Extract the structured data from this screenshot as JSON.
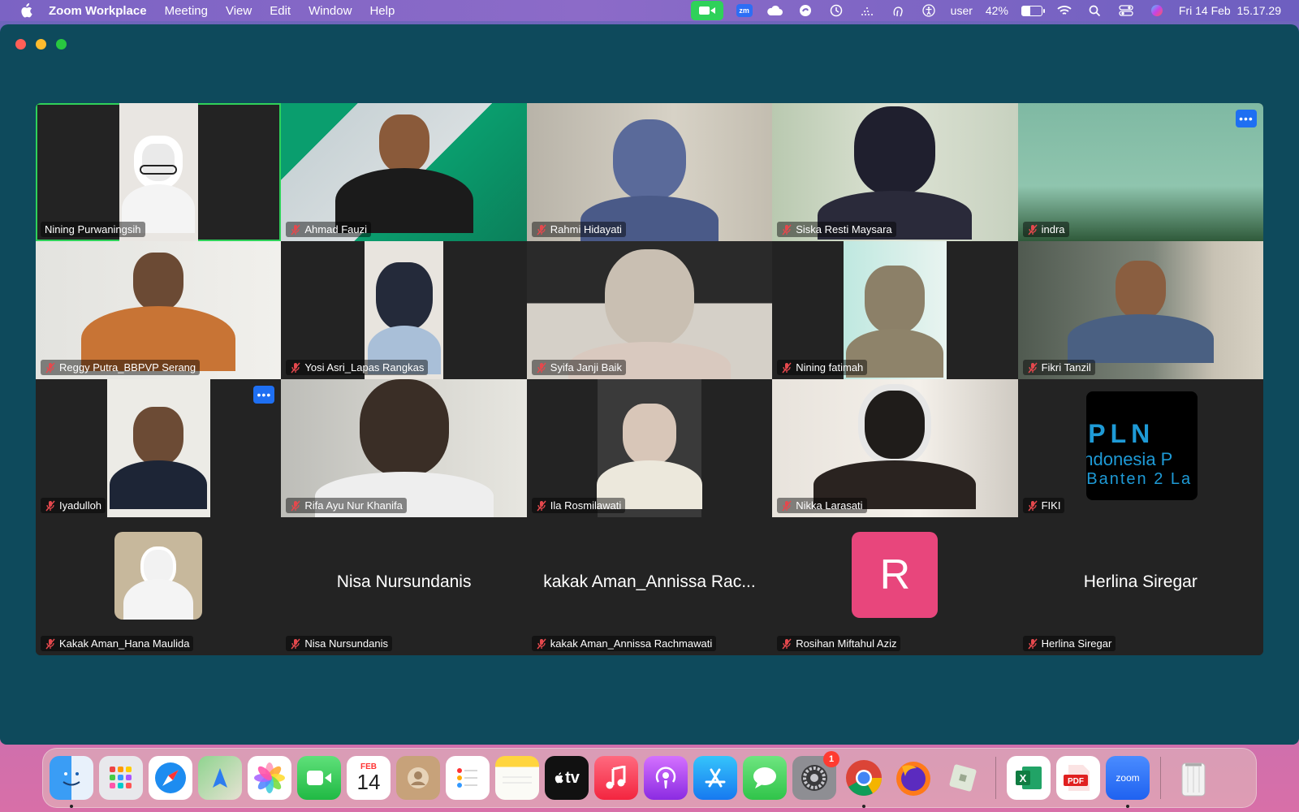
{
  "menubar": {
    "app_name": "Zoom Workplace",
    "menus": [
      "Meeting",
      "View",
      "Edit",
      "Window",
      "Help"
    ],
    "user": "user",
    "battery": "42%",
    "battery_level": 0.42,
    "datetime": "Fri 14 Feb  15.17.29",
    "zm_label": "zm"
  },
  "participants": [
    {
      "name": "Nining Purwaningsih",
      "muted": false,
      "active": true
    },
    {
      "name": "Ahmad Fauzi",
      "muted": true
    },
    {
      "name": "Rahmi Hidayati",
      "muted": true
    },
    {
      "name": "Siska Resti Maysara",
      "muted": true
    },
    {
      "name": "indra",
      "muted": true
    },
    {
      "name": "Reggy Putra_BBPVP Serang",
      "muted": true
    },
    {
      "name": "Yosi Asri_Lapas Rangkas",
      "muted": true
    },
    {
      "name": "Syifa Janji Baik",
      "muted": true
    },
    {
      "name": "Nining fatimah",
      "muted": true
    },
    {
      "name": "Fikri Tanzil",
      "muted": true
    },
    {
      "name": "Iyadulloh",
      "muted": true
    },
    {
      "name": "Rifa Ayu Nur Khanifa",
      "muted": true
    },
    {
      "name": "Ila Rosmilawati",
      "muted": true
    },
    {
      "name": "Nikka Larasati",
      "muted": true
    },
    {
      "name": "FIKI",
      "muted": true
    },
    {
      "name": "Kakak Aman_Hana Maulida",
      "muted": true
    },
    {
      "name": "Nisa Nursundanis",
      "muted": true,
      "display_name": "Nisa Nursundanis"
    },
    {
      "name": "kakak Aman_Annissa Rachmawati",
      "muted": true,
      "display_name": "kakak Aman_Annissa Rac..."
    },
    {
      "name": "Rosihan Miftahul Aziz",
      "muted": true,
      "avatar_letter": "R"
    },
    {
      "name": "Herlina Siregar",
      "muted": true,
      "display_name": "Herlina Siregar"
    }
  ],
  "pln_logo": {
    "line1": "PLN",
    "line2": "ndonesia P",
    "line3": "Banten 2 La"
  },
  "more_label": "•••",
  "dock": {
    "calendar_month": "FEB",
    "calendar_day": "14",
    "tv_label": "tv",
    "settings_badge": "1",
    "excel_label": "X",
    "pdf_label": "PDF",
    "zoom_label": "zoom"
  }
}
